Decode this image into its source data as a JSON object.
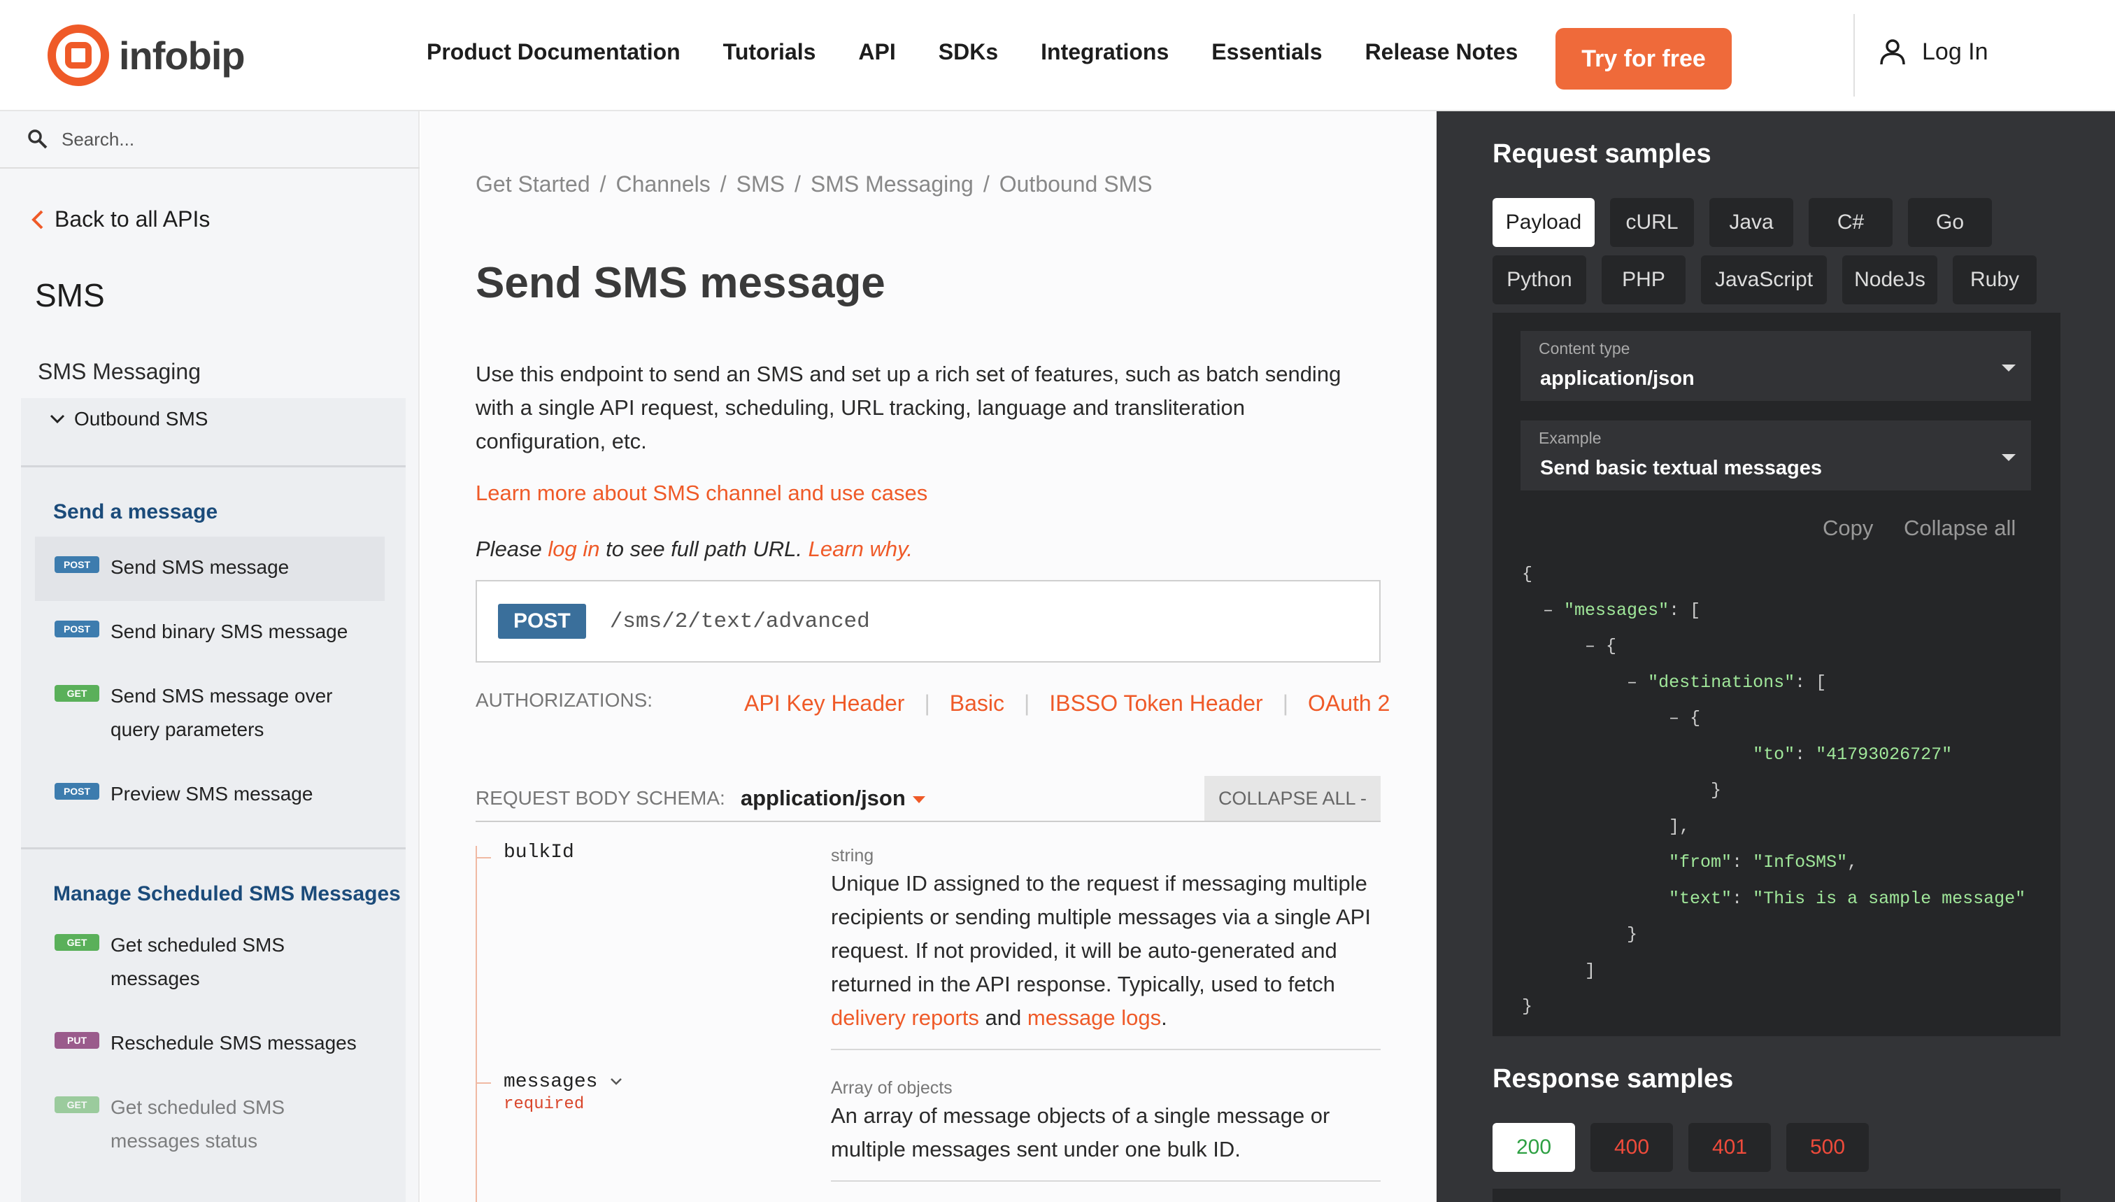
{
  "header": {
    "logo_text": "infobip",
    "nav": [
      "Product Documentation",
      "Tutorials",
      "API",
      "SDKs",
      "Integrations",
      "Essentials",
      "Release Notes"
    ],
    "try_label": "Try for free",
    "login_label": "Log In"
  },
  "sidebar": {
    "search_placeholder": "Search...",
    "back_label": "Back to all APIs",
    "api_title": "SMS",
    "group_label": "SMS Messaging",
    "subgroup_label": "Outbound SMS",
    "sections": [
      {
        "label": "Send a message",
        "items": [
          {
            "method": "POST",
            "label": "Send SMS message"
          },
          {
            "method": "POST",
            "label": "Send binary SMS message"
          },
          {
            "method": "GET",
            "label": "Send SMS message over query parameters"
          },
          {
            "method": "POST",
            "label": "Preview SMS message"
          }
        ]
      },
      {
        "label": "Manage Scheduled SMS Messages",
        "items": [
          {
            "method": "GET",
            "label": "Get scheduled SMS messages"
          },
          {
            "method": "PUT",
            "label": "Reschedule SMS messages"
          },
          {
            "method": "GET",
            "label": "Get scheduled SMS messages status"
          }
        ]
      }
    ]
  },
  "main": {
    "breadcrumbs": [
      "Get Started",
      "Channels",
      "SMS",
      "SMS Messaging",
      "Outbound SMS"
    ],
    "title": "Send SMS message",
    "description": "Use this endpoint to send an SMS and set up a rich set of features, such as batch sending with a single API request, scheduling, URL tracking, language and transliteration configuration, etc.",
    "learn_more": "Learn more about SMS channel and use cases",
    "please_prefix": "Please ",
    "login_link": "log in",
    "please_mid": " to see full path URL. ",
    "learn_why": "Learn why.",
    "method": "POST",
    "path": "/sms/2/text/advanced",
    "auth_label": "AUTHORIZATIONS:",
    "auth_links": [
      "API Key Header",
      "Basic",
      "IBSSO Token Header",
      "OAuth 2"
    ],
    "schema_label": "REQUEST BODY SCHEMA:",
    "schema_value": "application/json",
    "collapse_all": "COLLAPSE ALL -",
    "properties": [
      {
        "name": "bulkId",
        "type": "string",
        "desc_1": "Unique ID assigned to the request if messaging multiple recipients or sending multiple messages via a single API request. If not provided, it will be auto-generated and returned in the API response. Typically, used to fetch ",
        "link_1": "delivery reports",
        "desc_2": " and ",
        "link_2": "message logs",
        "desc_3": "."
      },
      {
        "name": "messages",
        "required": "required",
        "type": "Array of objects",
        "desc": "An array of message objects of a single message or multiple messages sent under one bulk ID."
      }
    ]
  },
  "right": {
    "request_title": "Request samples",
    "langs": [
      "Payload",
      "cURL",
      "Java",
      "C#",
      "Go",
      "Python",
      "PHP",
      "JavaScript",
      "NodeJs",
      "Ruby"
    ],
    "content_type_label": "Content type",
    "content_type_value": "application/json",
    "example_label": "Example",
    "example_value": "Send basic textual messages",
    "copy": "Copy",
    "collapse_all": "Collapse all",
    "json": {
      "messages_key": "\"messages\"",
      "destinations_key": "\"destinations\"",
      "to_key": "\"to\"",
      "to_val": "\"41793026727\"",
      "from_key": "\"from\"",
      "from_val": "\"InfoSMS\"",
      "text_key": "\"text\"",
      "text_val": "\"This is a sample message\""
    },
    "response_title": "Response samples",
    "codes": [
      "200",
      "400",
      "401",
      "500"
    ],
    "colors": {
      "accent": "#ef5a28",
      "panel": "#333437",
      "ok": "#2ea043",
      "err": "#ef4b3b"
    }
  }
}
